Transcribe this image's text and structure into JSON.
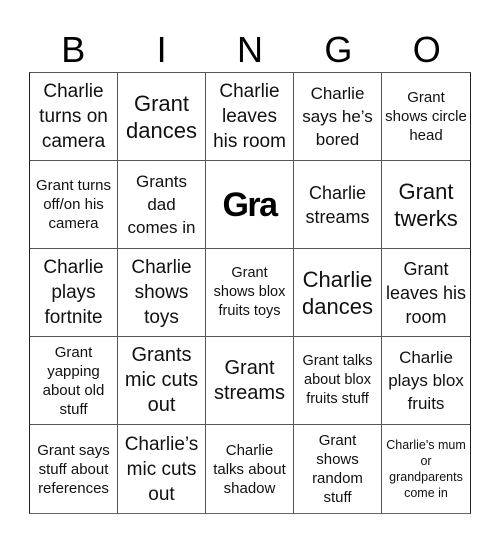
{
  "header": {
    "letters": [
      "B",
      "I",
      "N",
      "G",
      "O"
    ]
  },
  "card": {
    "rows": [
      [
        {
          "text": "Charlie turns on camera"
        },
        {
          "text": "Grant dances"
        },
        {
          "text": "Charlie leaves his room"
        },
        {
          "text": "Charlie says he’s bored"
        },
        {
          "text": "Grant shows circle head"
        }
      ],
      [
        {
          "text": "Grant turns off/on his camera"
        },
        {
          "text": "Grants dad comes in"
        },
        {
          "text": "Gra",
          "free_space": true
        },
        {
          "text": "Charlie streams"
        },
        {
          "text": "Grant twerks"
        }
      ],
      [
        {
          "text": "Charlie plays fortnite"
        },
        {
          "text": "Charlie shows toys"
        },
        {
          "text": "Grant shows blox fruits toys"
        },
        {
          "text": "Charlie dances"
        },
        {
          "text": "Grant leaves his room"
        }
      ],
      [
        {
          "text": "Grant yapping about old stuff"
        },
        {
          "text": "Grants mic cuts out"
        },
        {
          "text": "Grant streams"
        },
        {
          "text": "Grant talks about blox fruits stuff"
        },
        {
          "text": "Charlie plays blox fruits"
        }
      ],
      [
        {
          "text": "Grant says stuff about references"
        },
        {
          "text": "Charlie’s mic cuts out"
        },
        {
          "text": "Charlie talks about shadow"
        },
        {
          "text": "Grant shows random stuff"
        },
        {
          "text": "Charlie's mum or grandparents come in"
        }
      ]
    ]
  },
  "colors": {
    "text": "#000000",
    "grid_line": "#555555",
    "background": "#ffffff"
  }
}
